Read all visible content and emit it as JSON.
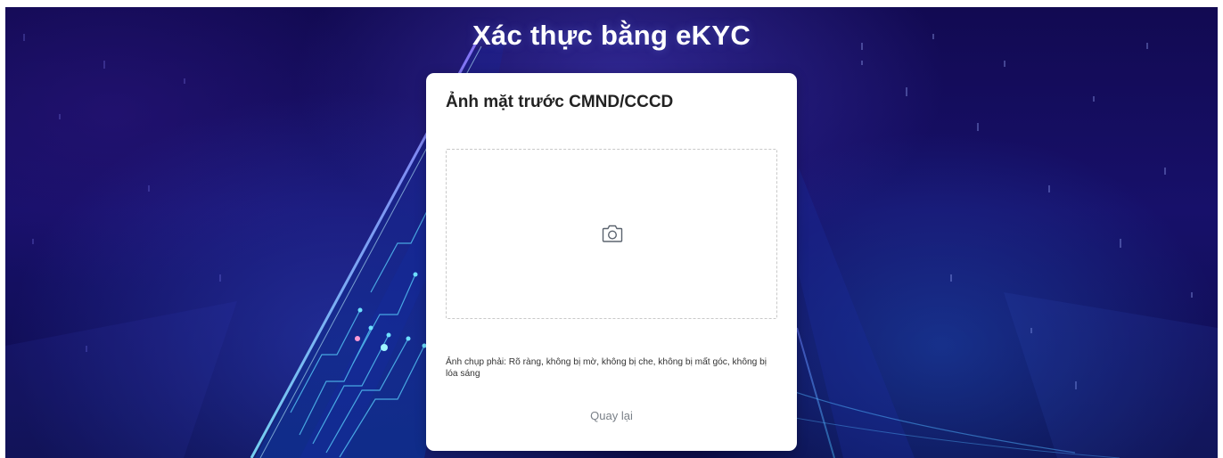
{
  "page": {
    "title": "Xác thực bằng eKYC"
  },
  "card": {
    "title": "Ảnh mặt trước CMND/CCCD",
    "upload_icon": "camera-icon",
    "hint": "Ảnh chụp phải: Rõ ràng, không bị mờ, không bị che, không bị mất góc, không bị lóa sáng",
    "back_label": "Quay lại"
  },
  "colors": {
    "background": "#17106a",
    "card": "#ffffff",
    "title_text": "#ffffff",
    "back_link": "#7a8088"
  }
}
